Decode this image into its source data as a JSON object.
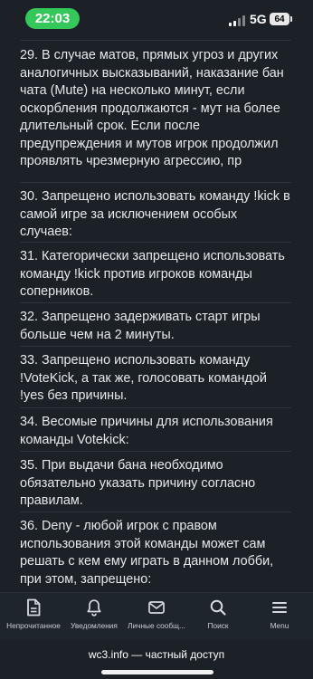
{
  "status_bar": {
    "time": "22:03",
    "network": "5G",
    "battery": "64"
  },
  "rules": [
    {
      "text": "29. В случае матов, прямых угроз и других аналогичных высказываний, наказание бан чата (Mute) на несколько минут, если оскорбления продолжаются - мут на более длительный срок. Если после предупреждения и мутов игрок продолжил проявлять чрезмерную агрессию, пр"
    },
    {
      "text": "30. Запрещено использовать команду !kick в самой игре за исключением особых случаев:"
    },
    {
      "text": "31. Категорически запрещено использовать команду !kick против игроков команды соперников."
    },
    {
      "text": "32. Запрещено задерживать старт игры больше чем на 2 минуты."
    },
    {
      "text": "33. Запрещено использовать команду !VoteKick, а так же, голосовать командой !yes без причины."
    },
    {
      "text": "34. Весомые причины для использования команды Votekick:"
    },
    {
      "text": "35. При выдачи бана необходимо обязательно указать причину согласно правилам."
    },
    {
      "text": "36. Deny - любой игрок с правом использования этой команды может сам решать с кем ему играть в данном лобби, при этом, запрещено:"
    }
  ],
  "bottom_nav": [
    {
      "label": "Непрочитанное",
      "icon": "document-icon"
    },
    {
      "label": "Уведомления",
      "icon": "bell-icon"
    },
    {
      "label": "Личные сообщ...",
      "icon": "envelope-icon"
    },
    {
      "label": "Поиск",
      "icon": "search-icon"
    },
    {
      "label": "Menu",
      "icon": "hamburger-menu-icon"
    }
  ],
  "address_bar": {
    "text": "wc3.info — частный доступ"
  }
}
